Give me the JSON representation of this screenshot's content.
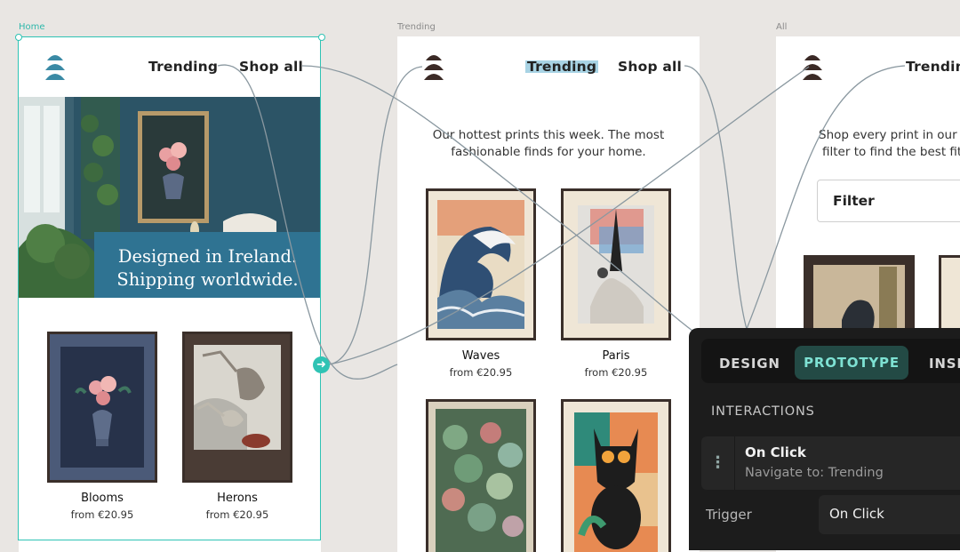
{
  "frames": {
    "home": {
      "label": "Home",
      "nav": [
        "Trending",
        "Shop all"
      ],
      "hero_text": [
        "Designed in Ireland.",
        "Shipping worldwide."
      ],
      "products": [
        {
          "name": "Blooms",
          "price": "from €20.95"
        },
        {
          "name": "Herons",
          "price": "from €20.95"
        }
      ]
    },
    "trending": {
      "label": "Trending",
      "nav": [
        "Trending",
        "Shop all"
      ],
      "intro": [
        "Our hottest prints this week. The most",
        "fashionable finds for your home."
      ],
      "products": [
        {
          "name": "Waves",
          "price": "from €20.95"
        },
        {
          "name": "Paris",
          "price": "from €20.95"
        }
      ]
    },
    "all": {
      "label": "All",
      "nav": [
        "Trending"
      ],
      "intro": [
        "Shop every print in our ar",
        "filter to find the best fit y"
      ],
      "filter_label": "Filter"
    }
  },
  "panel": {
    "tabs": [
      "DESIGN",
      "PROTOTYPE",
      "INSP"
    ],
    "active_tab": "PROTOTYPE",
    "section": "INTERACTIONS",
    "interaction": {
      "title": "On Click",
      "subtitle": "Navigate to: Trending"
    },
    "trigger_label": "Trigger",
    "trigger_value": "On Click"
  },
  "colors": {
    "accent": "#2fc3b4",
    "brand_teal": "#2f7392",
    "panel_bg": "#1c1c1c",
    "highlight": "#a8d3e4"
  }
}
